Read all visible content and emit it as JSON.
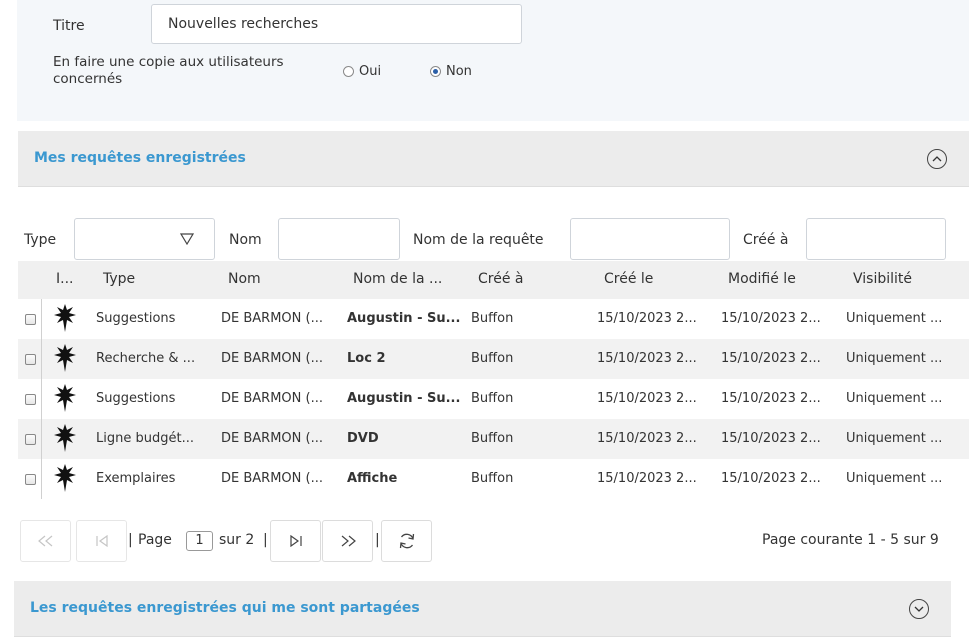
{
  "form": {
    "title_label": "Titre",
    "title_value": "Nouvelles recherches",
    "copy_label_line1": "En faire une copie aux utilisateurs",
    "copy_label_line2": "concernés",
    "option_yes": "Oui",
    "option_no": "Non",
    "selected": "Non"
  },
  "section_mine": {
    "title": "Mes requêtes enregistrées",
    "state": "expanded"
  },
  "filters": {
    "type_label": "Type",
    "nom_label": "Nom",
    "requete_label": "Nom de la requête",
    "cree_a_label": "Créé à"
  },
  "table": {
    "headers": [
      "I...",
      "Type",
      "Nom",
      "Nom de la ...",
      "Créé à",
      "Créé le",
      "Modifié le",
      "Visibilité"
    ],
    "rows": [
      {
        "type": "Suggestions",
        "nom": "DE BARMON (...",
        "requete": "Augustin - Su...",
        "cree_a": "Buffon",
        "cree_le": "15/10/2023 2...",
        "modifie_le": "15/10/2023 2...",
        "visibilite": "Uniquement ..."
      },
      {
        "type": "Recherche & ...",
        "nom": "DE BARMON (...",
        "requete": "Loc 2",
        "cree_a": "Buffon",
        "cree_le": "15/10/2023 2...",
        "modifie_le": "15/10/2023 2...",
        "visibilite": "Uniquement ..."
      },
      {
        "type": "Suggestions",
        "nom": "DE BARMON (...",
        "requete": "Augustin - Su...",
        "cree_a": "Buffon",
        "cree_le": "15/10/2023 2...",
        "modifie_le": "15/10/2023 2...",
        "visibilite": "Uniquement ..."
      },
      {
        "type": "Ligne budgét...",
        "nom": "DE BARMON (...",
        "requete": "DVD",
        "cree_a": "Buffon",
        "cree_le": "15/10/2023 2...",
        "modifie_le": "15/10/2023 2...",
        "visibilite": "Uniquement ..."
      },
      {
        "type": "Exemplaires",
        "nom": "DE BARMON (...",
        "requete": "Affiche",
        "cree_a": "Buffon",
        "cree_le": "15/10/2023 2...",
        "modifie_le": "15/10/2023 2...",
        "visibilite": "Uniquement ..."
      }
    ]
  },
  "pager": {
    "sep": "|",
    "page_label": "Page",
    "current_page": "1",
    "total_label": "sur 2",
    "status": "Page courante 1 - 5 sur 9"
  },
  "section_shared": {
    "title": "Les requêtes enregistrées qui me sont partagées",
    "state": "collapsed"
  },
  "icons": [
    "ermine-icon",
    "first-page-icon",
    "prev-page-icon",
    "next-page-icon",
    "last-page-icon",
    "refresh-icon",
    "chevron-up-icon",
    "chevron-down-icon",
    "filter-icon"
  ],
  "colors": {
    "accent": "#3b98d0",
    "section_bg": "#ececec",
    "panel_bg": "#f4f7fa"
  }
}
